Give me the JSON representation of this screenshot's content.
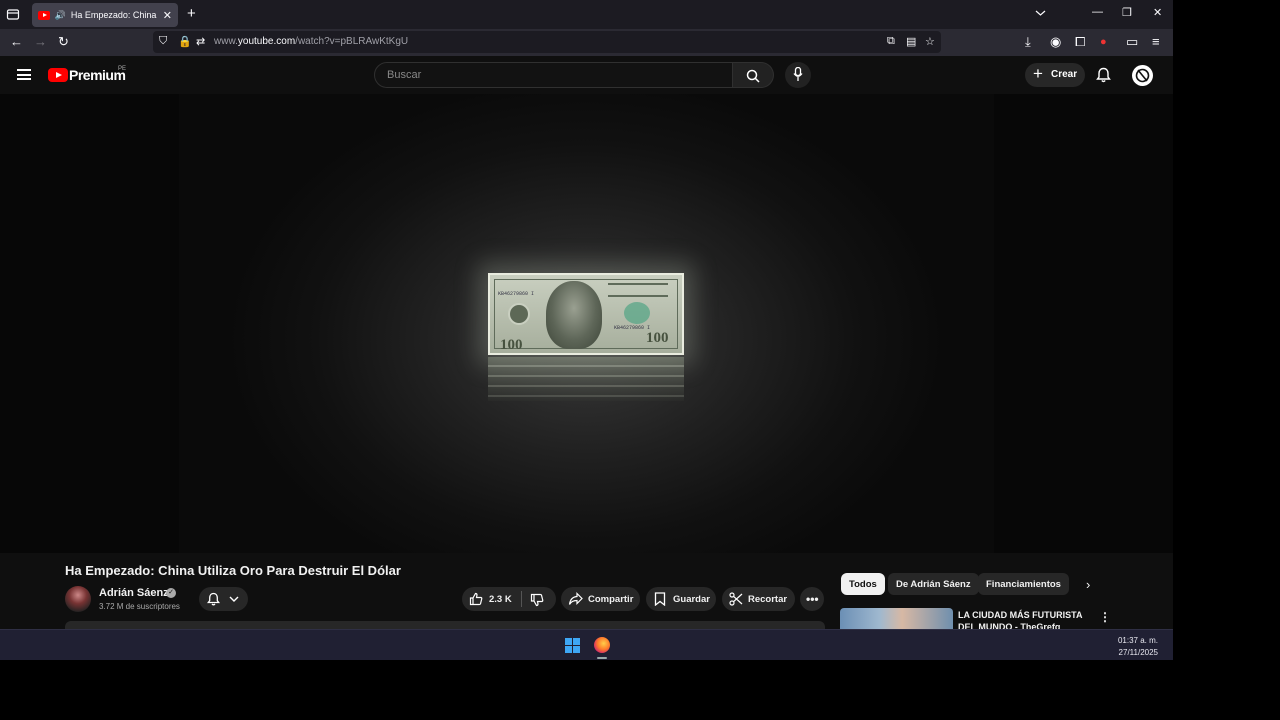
{
  "browser": {
    "tab_title": "Ha Empezado: China Utiliza Oro Para Destruir El Dólar",
    "url_prefix": "www.",
    "url_domain": "youtube.com",
    "url_path": "/watch?v=pBLRAwKtKgU"
  },
  "masthead": {
    "brand": "Premium",
    "region": "PE",
    "search_placeholder": "Buscar",
    "create_label": "Crear"
  },
  "video": {
    "title": "Ha Empezado: China Utiliza Oro Para Destruir El Dólar",
    "bill_value": "100",
    "bill_serial": "KB46279860 I"
  },
  "channel": {
    "name": "Adrián Sáenz",
    "subscribers": "3.72 M de suscriptores"
  },
  "actions": {
    "likes": "2.3 K",
    "share": "Compartir",
    "save": "Guardar",
    "clip": "Recortar"
  },
  "chips": [
    "Todos",
    "De Adrián Sáenz",
    "Financiamientos"
  ],
  "recommendation": {
    "title": "LA CIUDAD MÁS FUTURISTA DEL MUNDO - TheGrefg"
  },
  "taskbar": {
    "time": "01:37 a. m.",
    "date": "27/11/2025"
  },
  "colors": {
    "brand_red": "#ff0000",
    "page_bg": "#0f0f0f",
    "tab_active": "#42414d"
  }
}
